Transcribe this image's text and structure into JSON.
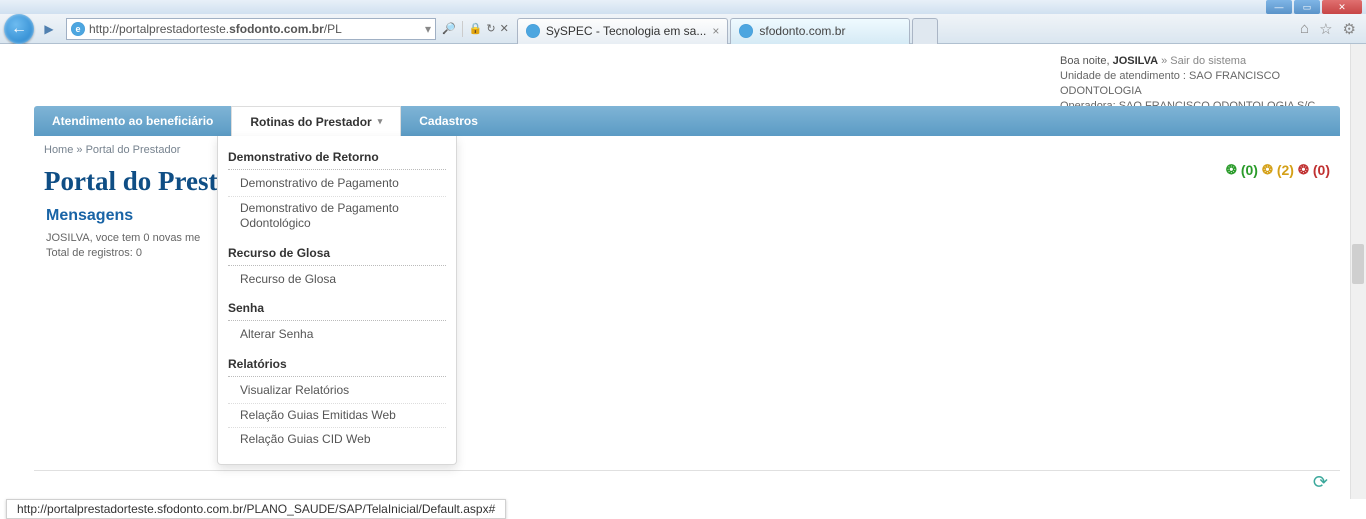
{
  "window": {
    "min": "—",
    "max": "▭",
    "close": "✕"
  },
  "browser": {
    "url_prefix": "http://portalprestadorteste.",
    "url_bold": "sfodonto.com.br",
    "url_suffix": "/PL",
    "lock_icon": "🔒",
    "tabs": [
      {
        "label": "SySPEC - Tecnologia em sa...",
        "active": true
      },
      {
        "label": "sfodonto.com.br",
        "active": false
      }
    ],
    "right_icons": {
      "home": "⌂",
      "star": "☆",
      "gear": "⚙"
    }
  },
  "header": {
    "greeting_prefix": "Boa noite, ",
    "user": "JOSILVA",
    "logout_sep": "   » ",
    "logout": "Sair do sistema",
    "unit_line": "Unidade de atendimento : SAO FRANCISCO ODONTOLOGIA",
    "op_line": "Operadora: SAO FRANCISCO ODONTOLOGIA S/C LTDA"
  },
  "menu": {
    "items": [
      {
        "label": "Atendimento ao beneficiário"
      },
      {
        "label": "Rotinas do Prestador",
        "active": true
      },
      {
        "label": "Cadastros"
      }
    ]
  },
  "breadcrumb": {
    "home": "Home",
    "sep": "   » ",
    "current": "Portal do Prestador"
  },
  "page_title": "Portal do Prest",
  "indicators": {
    "green": "(0)",
    "yellow": "(2)",
    "red": "(0)"
  },
  "messages": {
    "title": "Mensagens",
    "line1": "JOSILVA, voce tem 0 novas me",
    "line2": "Total de registros: 0"
  },
  "dropdown": {
    "sections": [
      {
        "head": "Demonstrativo de Retorno",
        "links": [
          "Demonstrativo de Pagamento",
          "Demonstrativo de Pagamento Odontológico"
        ]
      },
      {
        "head": "Recurso de Glosa",
        "links": [
          "Recurso de Glosa"
        ]
      },
      {
        "head": "Senha",
        "links": [
          "Alterar Senha"
        ]
      },
      {
        "head": "Relatórios",
        "links": [
          "Visualizar Relatórios",
          "Relação Guias Emitidas Web",
          "Relação Guias CID Web"
        ]
      }
    ]
  },
  "status_url": "http://portalprestadorteste.sfodonto.com.br/PLANO_SAUDE/SAP/TelaInicial/Default.aspx#"
}
